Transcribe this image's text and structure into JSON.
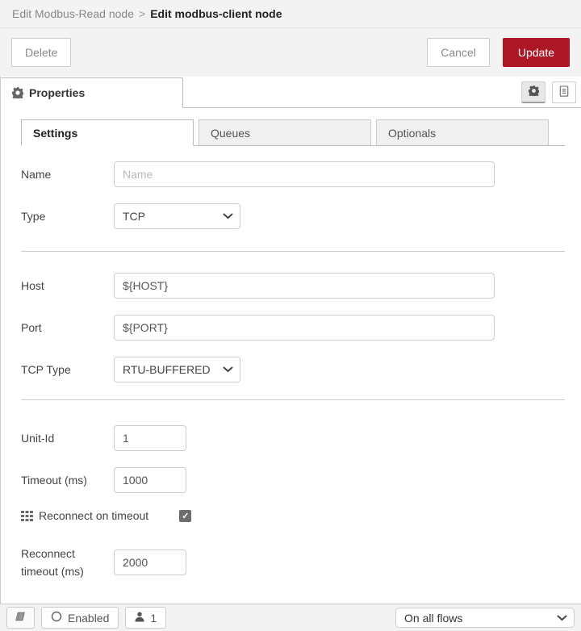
{
  "header": {
    "breadcrumb": {
      "parent": "Edit Modbus-Read node",
      "separator": ">",
      "current": "Edit modbus-client node"
    },
    "delete_label": "Delete",
    "cancel_label": "Cancel",
    "update_label": "Update"
  },
  "colors": {
    "update_red": "#AD1625",
    "toolbar_bg": "#f3f3f3",
    "border": "#ccc"
  },
  "properties_tab": {
    "label": "Properties"
  },
  "tabs": {
    "settings": "Settings",
    "queues": "Queues",
    "optionals": "Optionals"
  },
  "form": {
    "name": {
      "label": "Name",
      "value": "",
      "placeholder": "Name"
    },
    "type": {
      "label": "Type",
      "value": "TCP"
    },
    "host": {
      "label": "Host",
      "value": "${HOST}"
    },
    "port": {
      "label": "Port",
      "value": "${PORT}"
    },
    "tcp_type": {
      "label": "TCP Type",
      "value": "RTU-BUFFERED"
    },
    "unit_id": {
      "label": "Unit-Id",
      "value": "1"
    },
    "timeout": {
      "label": "Timeout (ms)",
      "value": "1000"
    },
    "reconnect_on_timeout": {
      "label": "Reconnect on timeout",
      "checked": true
    },
    "reconnect_timeout": {
      "label": "Reconnect timeout (ms)",
      "value": "2000"
    }
  },
  "footer": {
    "enabled_label": "Enabled",
    "instance_count": "1",
    "scope_value": "On all flows"
  },
  "icons": {
    "properties_gear": "gear-icon",
    "description_doc": "document-icon",
    "reconnect_grid": "grid-icon",
    "library_book": "book-icon",
    "enabled_circle": "circle-icon",
    "user": "user-icon"
  }
}
